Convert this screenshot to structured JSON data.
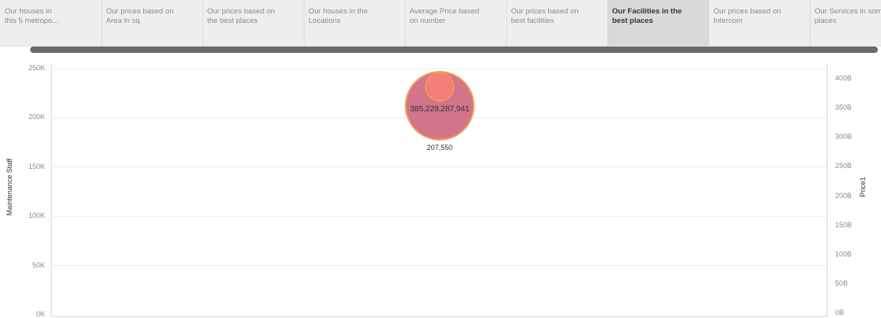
{
  "tabs": [
    {
      "line1": "Our houses in",
      "line2": "this 5 metropo..."
    },
    {
      "line1": "Our prices based on",
      "line2": "Area in sq"
    },
    {
      "line1": "Our prices based on",
      "line2": "the best places"
    },
    {
      "line1": "Our houses in the",
      "line2": "Locations"
    },
    {
      "line1": "Average Price based",
      "line2": "on number"
    },
    {
      "line1": "Our prices based on",
      "line2": "best facilities"
    },
    {
      "line1": "Our Facilities in the",
      "line2": "best places",
      "active": true
    },
    {
      "line1": "Our prices based on",
      "line2": "Intercom"
    },
    {
      "line1": "Our Services in some",
      "line2": "places"
    }
  ],
  "chart_data": {
    "type": "scatter",
    "ylabel_left": "Maintenance Staff",
    "ylabel_right": "Price1",
    "left_axis": {
      "ticks": [
        "250K",
        "200K",
        "150K",
        "100K",
        "50K",
        "0K"
      ],
      "ylim": [
        0,
        250000
      ]
    },
    "right_axis": {
      "ticks": [
        "400B",
        "350B",
        "300B",
        "250B",
        "200B",
        "150B",
        "100B",
        "50B",
        "0B"
      ],
      "ylim": [
        0,
        400000000000
      ]
    },
    "grid": true,
    "points": [
      {
        "maintenance_staff": 207550,
        "price1": 385229287941,
        "label_price": "385,229,287,941",
        "label_staff": "207,550"
      }
    ],
    "colors": {
      "outer_circle": "#d2748a",
      "outer_stroke": "#f0a050",
      "inner_circle": "#f47f7a",
      "grid": "#ececec"
    }
  }
}
